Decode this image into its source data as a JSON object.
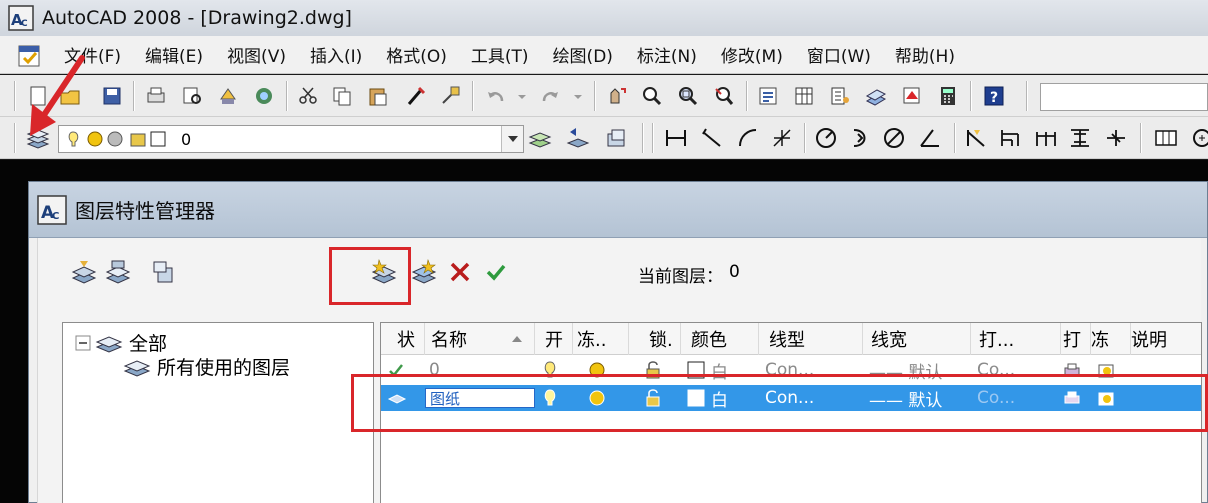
{
  "window": {
    "title": "AutoCAD 2008 - [Drawing2.dwg]"
  },
  "menu": {
    "items": [
      "文件(F)",
      "编辑(E)",
      "视图(V)",
      "插入(I)",
      "格式(O)",
      "工具(T)",
      "绘图(D)",
      "标注(N)",
      "修改(M)",
      "窗口(W)",
      "帮助(H)"
    ]
  },
  "layer_toolbar": {
    "current_layer": "0"
  },
  "dialog": {
    "title": "图层特性管理器",
    "current_layer_label": "当前图层：",
    "current_layer_value": "0",
    "tree": {
      "root": "全部",
      "child": "所有使用的图层"
    },
    "columns": [
      "状",
      "名称",
      "开",
      "冻..",
      "锁.",
      "颜色",
      "线型",
      "线宽",
      "打...",
      "打",
      "冻",
      "说明"
    ],
    "rows": [
      {
        "name": "0",
        "color": "白",
        "linetype": "Con...",
        "lineweight": "—— 默认",
        "plotstyle": "Co..."
      },
      {
        "name": "图纸",
        "color": "白",
        "linetype": "Con...",
        "lineweight": "—— 默认",
        "plotstyle": "Co..."
      }
    ]
  },
  "colors": {
    "accent_red": "#d9262a",
    "selected_row": "#3397e8"
  }
}
